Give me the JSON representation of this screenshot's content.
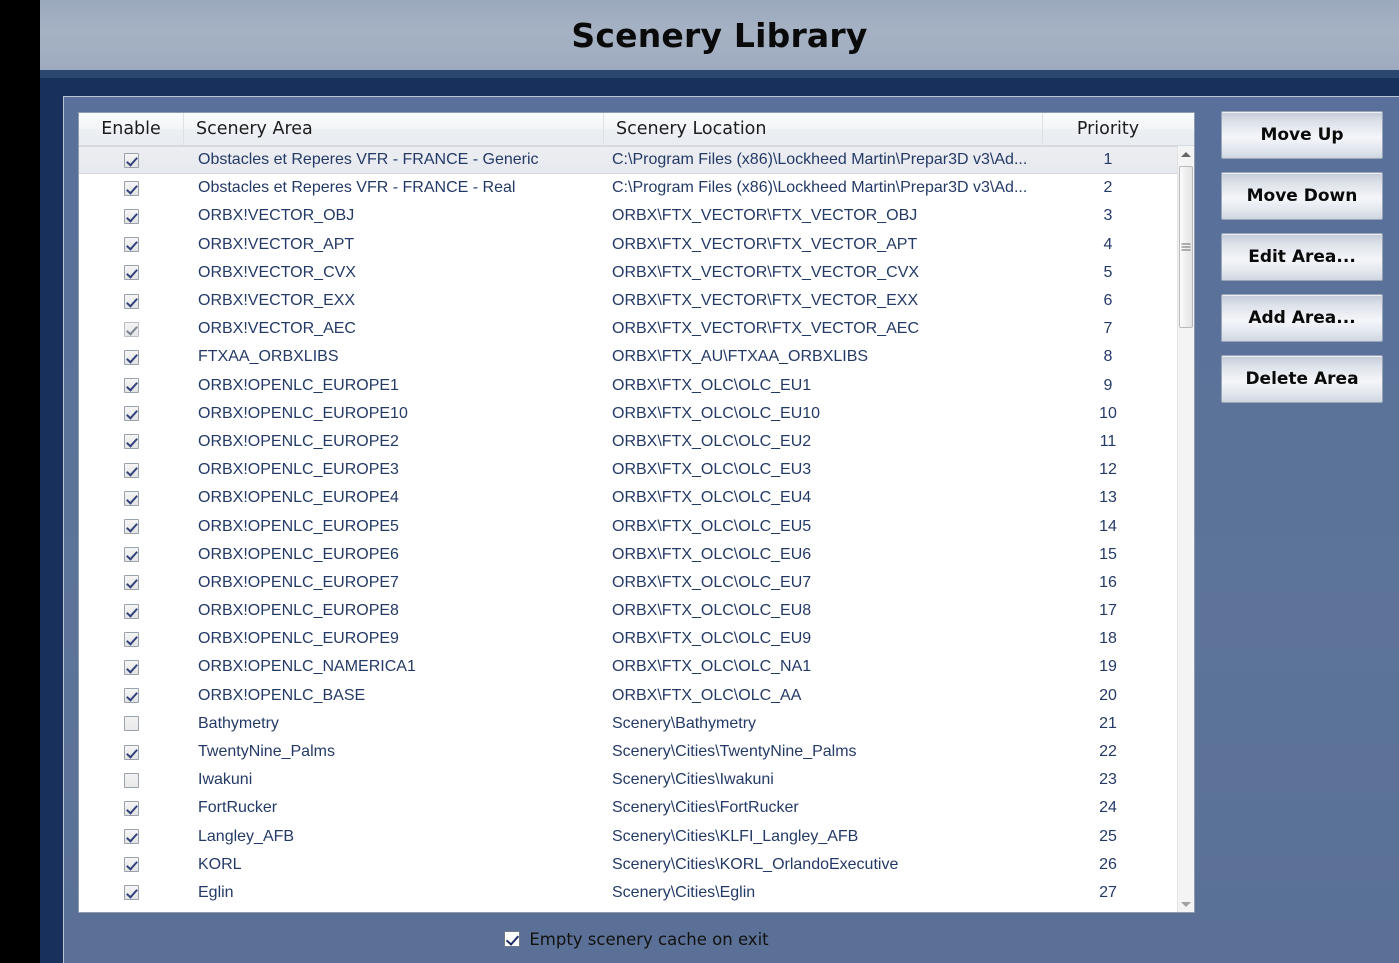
{
  "window": {
    "title": "Scenery Library"
  },
  "table": {
    "columns": [
      "Enable",
      "Scenery Area",
      "Scenery Location",
      "Priority"
    ],
    "rows": [
      {
        "enabled": true,
        "dim": false,
        "area": "Obstacles et Reperes VFR - FRANCE - Generic",
        "location": "C:\\Program Files (x86)\\Lockheed Martin\\Prepar3D v3\\Ad...",
        "priority": "1",
        "selected": true
      },
      {
        "enabled": true,
        "dim": false,
        "area": "Obstacles et Reperes VFR - FRANCE - Real",
        "location": "C:\\Program Files (x86)\\Lockheed Martin\\Prepar3D v3\\Ad...",
        "priority": "2",
        "selected": false
      },
      {
        "enabled": true,
        "dim": false,
        "area": "ORBX!VECTOR_OBJ",
        "location": "ORBX\\FTX_VECTOR\\FTX_VECTOR_OBJ",
        "priority": "3",
        "selected": false
      },
      {
        "enabled": true,
        "dim": false,
        "area": "ORBX!VECTOR_APT",
        "location": "ORBX\\FTX_VECTOR\\FTX_VECTOR_APT",
        "priority": "4",
        "selected": false
      },
      {
        "enabled": true,
        "dim": false,
        "area": "ORBX!VECTOR_CVX",
        "location": "ORBX\\FTX_VECTOR\\FTX_VECTOR_CVX",
        "priority": "5",
        "selected": false
      },
      {
        "enabled": true,
        "dim": false,
        "area": "ORBX!VECTOR_EXX",
        "location": "ORBX\\FTX_VECTOR\\FTX_VECTOR_EXX",
        "priority": "6",
        "selected": false
      },
      {
        "enabled": true,
        "dim": true,
        "area": "ORBX!VECTOR_AEC",
        "location": "ORBX\\FTX_VECTOR\\FTX_VECTOR_AEC",
        "priority": "7",
        "selected": false
      },
      {
        "enabled": true,
        "dim": false,
        "area": "FTXAA_ORBXLIBS",
        "location": "ORBX\\FTX_AU\\FTXAA_ORBXLIBS",
        "priority": "8",
        "selected": false
      },
      {
        "enabled": true,
        "dim": false,
        "area": "ORBX!OPENLC_EUROPE1",
        "location": "ORBX\\FTX_OLC\\OLC_EU1",
        "priority": "9",
        "selected": false
      },
      {
        "enabled": true,
        "dim": false,
        "area": "ORBX!OPENLC_EUROPE10",
        "location": "ORBX\\FTX_OLC\\OLC_EU10",
        "priority": "10",
        "selected": false
      },
      {
        "enabled": true,
        "dim": false,
        "area": "ORBX!OPENLC_EUROPE2",
        "location": "ORBX\\FTX_OLC\\OLC_EU2",
        "priority": "11",
        "selected": false
      },
      {
        "enabled": true,
        "dim": false,
        "area": "ORBX!OPENLC_EUROPE3",
        "location": "ORBX\\FTX_OLC\\OLC_EU3",
        "priority": "12",
        "selected": false
      },
      {
        "enabled": true,
        "dim": false,
        "area": "ORBX!OPENLC_EUROPE4",
        "location": "ORBX\\FTX_OLC\\OLC_EU4",
        "priority": "13",
        "selected": false
      },
      {
        "enabled": true,
        "dim": false,
        "area": "ORBX!OPENLC_EUROPE5",
        "location": "ORBX\\FTX_OLC\\OLC_EU5",
        "priority": "14",
        "selected": false
      },
      {
        "enabled": true,
        "dim": false,
        "area": "ORBX!OPENLC_EUROPE6",
        "location": "ORBX\\FTX_OLC\\OLC_EU6",
        "priority": "15",
        "selected": false
      },
      {
        "enabled": true,
        "dim": false,
        "area": "ORBX!OPENLC_EUROPE7",
        "location": "ORBX\\FTX_OLC\\OLC_EU7",
        "priority": "16",
        "selected": false
      },
      {
        "enabled": true,
        "dim": false,
        "area": "ORBX!OPENLC_EUROPE8",
        "location": "ORBX\\FTX_OLC\\OLC_EU8",
        "priority": "17",
        "selected": false
      },
      {
        "enabled": true,
        "dim": false,
        "area": "ORBX!OPENLC_EUROPE9",
        "location": "ORBX\\FTX_OLC\\OLC_EU9",
        "priority": "18",
        "selected": false
      },
      {
        "enabled": true,
        "dim": false,
        "area": "ORBX!OPENLC_NAMERICA1",
        "location": "ORBX\\FTX_OLC\\OLC_NA1",
        "priority": "19",
        "selected": false
      },
      {
        "enabled": true,
        "dim": false,
        "area": "ORBX!OPENLC_BASE",
        "location": "ORBX\\FTX_OLC\\OLC_AA",
        "priority": "20",
        "selected": false
      },
      {
        "enabled": false,
        "dim": false,
        "area": "Bathymetry",
        "location": "Scenery\\Bathymetry",
        "priority": "21",
        "selected": false
      },
      {
        "enabled": true,
        "dim": false,
        "area": "TwentyNine_Palms",
        "location": "Scenery\\Cities\\TwentyNine_Palms",
        "priority": "22",
        "selected": false
      },
      {
        "enabled": false,
        "dim": false,
        "area": "Iwakuni",
        "location": "Scenery\\Cities\\Iwakuni",
        "priority": "23",
        "selected": false
      },
      {
        "enabled": true,
        "dim": false,
        "area": "FortRucker",
        "location": "Scenery\\Cities\\FortRucker",
        "priority": "24",
        "selected": false
      },
      {
        "enabled": true,
        "dim": false,
        "area": "Langley_AFB",
        "location": "Scenery\\Cities\\KLFI_Langley_AFB",
        "priority": "25",
        "selected": false
      },
      {
        "enabled": true,
        "dim": false,
        "area": "KORL",
        "location": "Scenery\\Cities\\KORL_OrlandoExecutive",
        "priority": "26",
        "selected": false
      },
      {
        "enabled": true,
        "dim": false,
        "area": "Eglin",
        "location": "Scenery\\Cities\\Eglin",
        "priority": "27",
        "selected": false
      },
      {
        "enabled": false,
        "dim": false,
        "area": "",
        "location": "",
        "priority": "",
        "selected": false
      }
    ]
  },
  "buttons": [
    {
      "label": "Move Up"
    },
    {
      "label": "Move Down"
    },
    {
      "label": "Edit Area..."
    },
    {
      "label": "Add Area..."
    },
    {
      "label": "Delete Area"
    }
  ],
  "footer": {
    "empty_cache_label": "Empty scenery cache on exit",
    "empty_cache_checked": true
  },
  "colors": {
    "title_band": "#a2aec2",
    "accent_navy": "#17305c",
    "dialog_body": "#5a7096",
    "row_text": "#243a66"
  }
}
